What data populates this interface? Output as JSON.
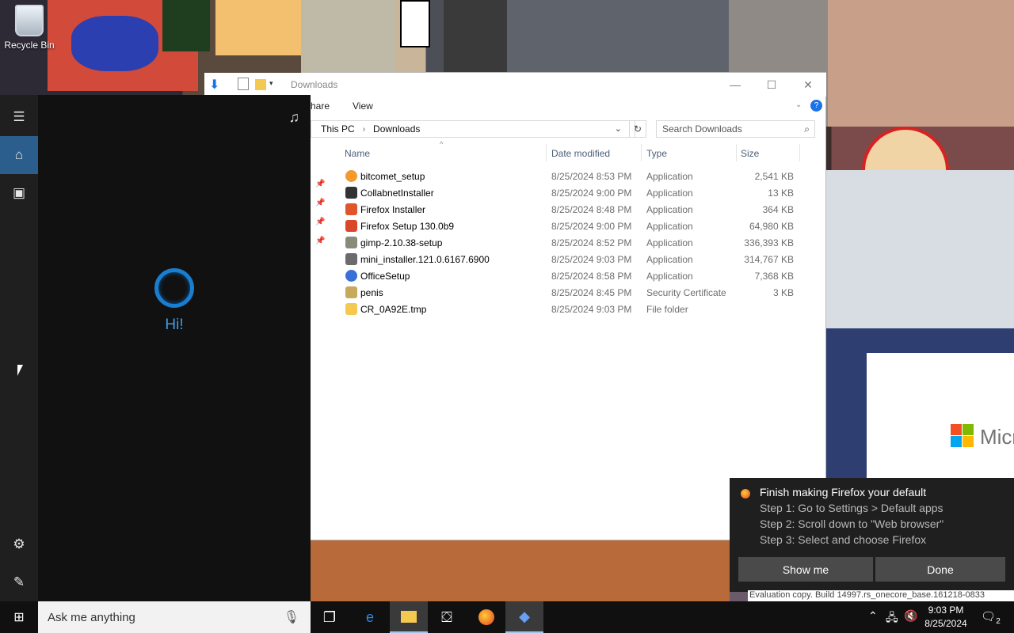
{
  "desktop": {
    "recycle_bin_label": "Recycle Bin",
    "brand_text": "Micr"
  },
  "cortana": {
    "greeting": "Hi!",
    "search_placeholder": "Ask me anything"
  },
  "explorer": {
    "title": "Downloads",
    "ribbon": {
      "share": "hare",
      "view": "View"
    },
    "breadcrumb": [
      "This PC",
      "Downloads"
    ],
    "search_placeholder": "Search Downloads",
    "columns": {
      "name": "Name",
      "date": "Date modified",
      "type": "Type",
      "size": "Size"
    },
    "files": [
      {
        "name": "bitcomet_setup",
        "date": "8/25/2024 8:53 PM",
        "type": "Application",
        "size": "2,541 KB",
        "icon": "bitcomet-icon",
        "color": "#f29a2e"
      },
      {
        "name": "CollabnetInstaller",
        "date": "8/25/2024 9:00 PM",
        "type": "Application",
        "size": "13 KB",
        "icon": "installer-icon",
        "color": "#333333"
      },
      {
        "name": "Firefox Installer",
        "date": "8/25/2024 8:48 PM",
        "type": "Application",
        "size": "364 KB",
        "icon": "firefox-icon",
        "color": "#e0552b"
      },
      {
        "name": "Firefox Setup 130.0b9",
        "date": "8/25/2024 9:00 PM",
        "type": "Application",
        "size": "64,980 KB",
        "icon": "firefox-setup-icon",
        "color": "#d9482a"
      },
      {
        "name": "gimp-2.10.38-setup",
        "date": "8/25/2024 8:52 PM",
        "type": "Application",
        "size": "336,393 KB",
        "icon": "gimp-icon",
        "color": "#8a8a7a"
      },
      {
        "name": "mini_installer.121.0.6167.6900",
        "date": "8/25/2024 9:03 PM",
        "type": "Application",
        "size": "314,767 KB",
        "icon": "mini-installer-icon",
        "color": "#6b6b6b"
      },
      {
        "name": "OfficeSetup",
        "date": "8/25/2024 8:58 PM",
        "type": "Application",
        "size": "7,368 KB",
        "icon": "office-icon",
        "color": "#3a6fd8"
      },
      {
        "name": "penis",
        "date": "8/25/2024 8:45 PM",
        "type": "Security Certificate",
        "size": "3 KB",
        "icon": "certificate-icon",
        "color": "#c8a85a"
      },
      {
        "name": "CR_0A92E.tmp",
        "date": "8/25/2024 9:03 PM",
        "type": "File folder",
        "size": "",
        "icon": "folder-icon",
        "color": "#f3c94f"
      }
    ]
  },
  "toast": {
    "title": "Finish making Firefox your default",
    "lines": [
      "Step 1: Go to Settings > Default apps",
      "Step 2: Scroll down to \"Web browser\"",
      "Step 3: Select and choose Firefox"
    ],
    "show_me": "Show me",
    "done": "Done"
  },
  "watermark": "Evaluation copy. Build 14997.rs_onecore_base.161218-0833",
  "taskbar": {
    "time": "9:03 PM",
    "date": "8/25/2024",
    "notification_count": "2"
  }
}
